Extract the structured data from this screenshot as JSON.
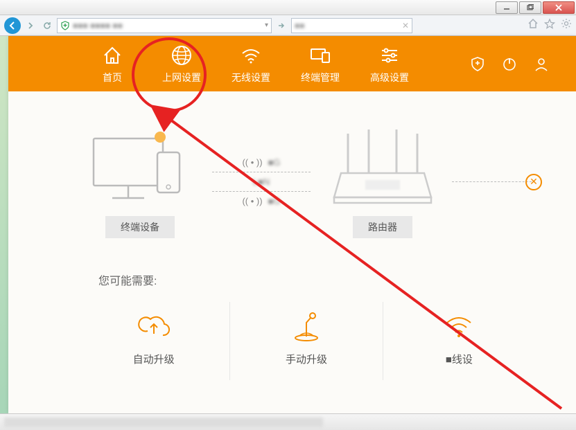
{
  "window": {
    "minimize_tip": "minimize",
    "maximize_tip": "restore",
    "close_tip": "close"
  },
  "browser": {
    "back_tip": "back",
    "forward_tip": "forward",
    "refresh_tip": "refresh",
    "address_blur": "■■■  ■■■■ ■■",
    "search_blur": "■■",
    "dropdown_tip": "▾",
    "home_tip": "home",
    "favorite_tip": "favorite",
    "settings_tip": "settings"
  },
  "nav": {
    "items": [
      {
        "label": "首页"
      },
      {
        "label": "上网设置"
      },
      {
        "label": "无线设置"
      },
      {
        "label": "终端管理"
      },
      {
        "label": "高级设置"
      }
    ],
    "right": {
      "security_tip": "security",
      "power_tip": "power",
      "user_tip": "user"
    }
  },
  "topology": {
    "device_label": "终端设备",
    "router_label": "路由器",
    "conn": {
      "top_blur": "■G",
      "mid": "L■N",
      "bottom_blur": "■G"
    },
    "error_glyph": "✕"
  },
  "need": {
    "title": "您可能需要:",
    "items": [
      {
        "label": "自动升级"
      },
      {
        "label": "手动升级"
      },
      {
        "label": "■线设"
      }
    ]
  },
  "colors": {
    "orange": "#f48c00",
    "red": "#e62222"
  }
}
